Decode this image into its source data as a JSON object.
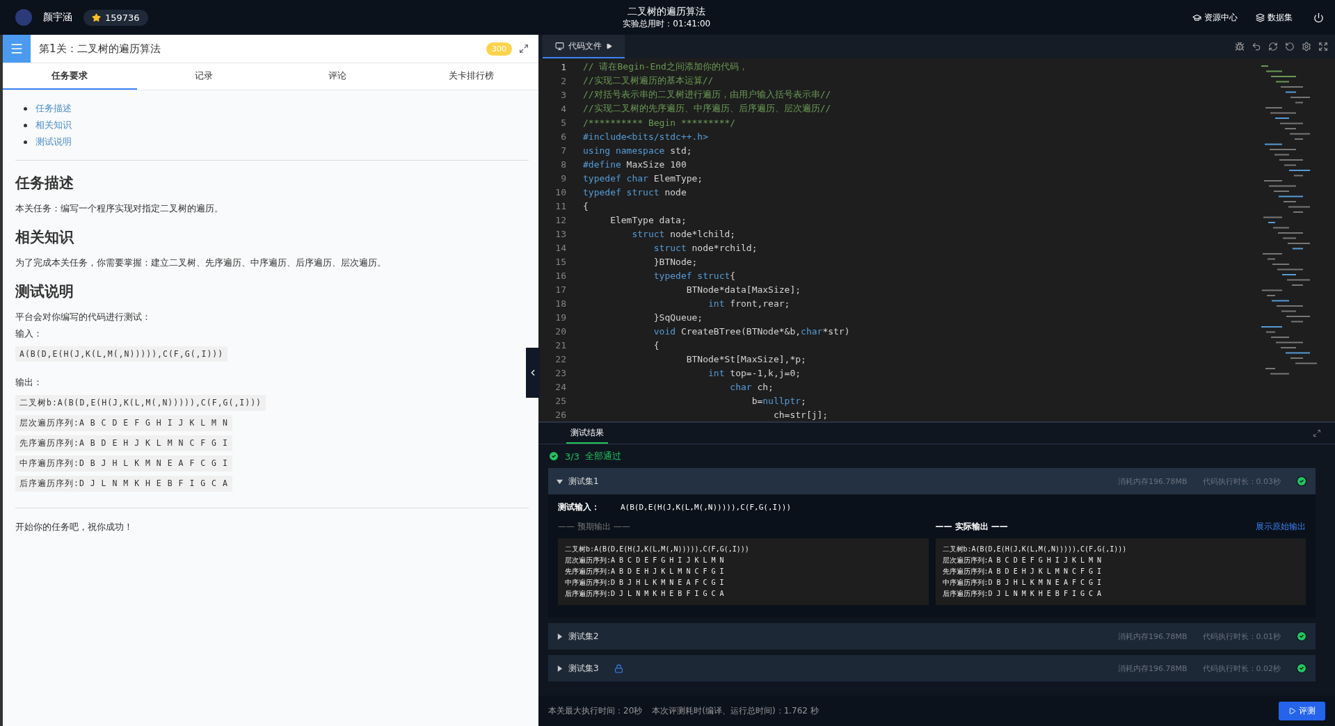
{
  "header": {
    "user_name": "颜宇涵",
    "coins": "159736",
    "title": "二叉树的遍历算法",
    "subtitle": "实验总用时：01:41:00",
    "links": [
      {
        "label": "资源中心",
        "kind": "resource"
      },
      {
        "label": "数据集",
        "kind": "dataset"
      }
    ]
  },
  "task": {
    "level_title": "第1关：二叉树的遍历算法",
    "score": "300",
    "tabs": [
      {
        "label": "任务要求",
        "selected": true
      },
      {
        "label": "记录",
        "selected": false
      },
      {
        "label": "评论",
        "selected": false
      },
      {
        "label": "关卡排行榜",
        "selected": false
      }
    ],
    "toc": [
      "任务描述",
      "相关知识",
      "测试说明"
    ],
    "sections": [
      {
        "heading": "任务描述",
        "blocks": [
          {
            "kind": "text",
            "text": "本关任务：编写一个程序实现对指定二叉树的遍历。"
          }
        ]
      },
      {
        "heading": "相关知识",
        "blocks": [
          {
            "kind": "text",
            "text": "为了完成本关任务，你需要掌握：建立二叉树、先序遍历、中序遍历、后序遍历、层次遍历。"
          }
        ]
      },
      {
        "heading": "测试说明",
        "blocks": [
          {
            "kind": "text",
            "text": "平台会对你编写的代码进行测试："
          },
          {
            "kind": "label",
            "text": "输入："
          },
          {
            "kind": "code",
            "text": "A(B(D,E(H(J,K(L,M(,N))))),C(F,G(,I)))"
          },
          {
            "kind": "label",
            "text": "输出："
          },
          {
            "kind": "code",
            "text": "二叉树b:A(B(D,E(H(J,K(L,M(,N))))),C(F,G(,I)))"
          },
          {
            "kind": "code",
            "text": "层次遍历序列:A B C D E F G H I J K L M N"
          },
          {
            "kind": "code",
            "text": "先序遍历序列:A B D E H J K L M N C F G I"
          },
          {
            "kind": "code",
            "text": "中序遍历序列:D B J H L K M N E A F C G I"
          },
          {
            "kind": "code",
            "text": "后序遍历序列:D J L N M K H E B F I G C A"
          }
        ]
      }
    ],
    "closing": "开始你的任务吧，祝你成功！"
  },
  "editor": {
    "tab_label": "代码文件",
    "lines": [
      {
        "n": "1",
        "tokens": [
          {
            "t": "// 请在Begin-End之间添加你的代码，",
            "kind": "comment"
          }
        ]
      },
      {
        "n": "2",
        "tokens": [
          {
            "t": "//实现二叉树遍历的基本运算//",
            "kind": "comment"
          }
        ]
      },
      {
        "n": "3",
        "tokens": [
          {
            "t": "//对括号表示串的二叉树进行遍历，由用户输入括号表示串//",
            "kind": "comment"
          }
        ]
      },
      {
        "n": "4",
        "tokens": [
          {
            "t": "//实现二叉树的先序遍历、中序遍历、后序遍历、层次遍历//",
            "kind": "comment"
          }
        ]
      },
      {
        "n": "5",
        "tokens": [
          {
            "t": "/********** Begin *********/",
            "kind": "comment"
          }
        ]
      },
      {
        "n": "6",
        "tokens": [
          {
            "t": "#include<bits/stdc++.h>",
            "kind": "keyword"
          }
        ]
      },
      {
        "n": "7",
        "tokens": [
          {
            "t": "using namespace",
            "kind": "keyword"
          },
          {
            "t": " std;",
            "kind": "plain"
          }
        ]
      },
      {
        "n": "8",
        "tokens": [
          {
            "t": "#define",
            "kind": "keyword"
          },
          {
            "t": " MaxSize 100",
            "kind": "plain"
          }
        ]
      },
      {
        "n": "9",
        "tokens": [
          {
            "t": "typedef char",
            "kind": "keyword"
          },
          {
            "t": " ElemType;",
            "kind": "plain"
          }
        ]
      },
      {
        "n": "10",
        "tokens": [
          {
            "t": "typedef struct",
            "kind": "keyword"
          },
          {
            "t": " node",
            "kind": "plain"
          }
        ]
      },
      {
        "n": "11",
        "tokens": [
          {
            "t": "{",
            "kind": "plain"
          }
        ]
      },
      {
        "n": "12",
        "tokens": [
          {
            "t": "     ElemType data;",
            "kind": "plain"
          }
        ]
      },
      {
        "n": "13",
        "tokens": [
          {
            "t": "         struct",
            "kind": "keyword"
          },
          {
            "t": " node*lchild;",
            "kind": "plain"
          }
        ]
      },
      {
        "n": "14",
        "tokens": [
          {
            "t": "             struct",
            "kind": "keyword"
          },
          {
            "t": " node*rchild;",
            "kind": "plain"
          }
        ]
      },
      {
        "n": "15",
        "tokens": [
          {
            "t": "             }BTNode;",
            "kind": "plain"
          }
        ]
      },
      {
        "n": "16",
        "tokens": [
          {
            "t": "             typedef struct",
            "kind": "keyword"
          },
          {
            "t": "{",
            "kind": "plain"
          }
        ]
      },
      {
        "n": "17",
        "tokens": [
          {
            "t": "                   BTNode*data[MaxSize];",
            "kind": "plain"
          }
        ]
      },
      {
        "n": "18",
        "tokens": [
          {
            "t": "                       int",
            "kind": "keyword"
          },
          {
            "t": " front,rear;",
            "kind": "plain"
          }
        ]
      },
      {
        "n": "19",
        "tokens": [
          {
            "t": "             }SqQueue;",
            "kind": "plain"
          }
        ]
      },
      {
        "n": "20",
        "tokens": [
          {
            "t": "             void",
            "kind": "keyword"
          },
          {
            "t": " CreateBTree(BTNode*&b,",
            "kind": "plain"
          },
          {
            "t": "char",
            "kind": "keyword"
          },
          {
            "t": "*str)",
            "kind": "plain"
          }
        ]
      },
      {
        "n": "21",
        "tokens": [
          {
            "t": "             {",
            "kind": "plain"
          }
        ]
      },
      {
        "n": "22",
        "tokens": [
          {
            "t": "                   BTNode*St[MaxSize],*p;",
            "kind": "plain"
          }
        ]
      },
      {
        "n": "23",
        "tokens": [
          {
            "t": "                       int",
            "kind": "keyword"
          },
          {
            "t": " top=-1,k,j=0;",
            "kind": "plain"
          }
        ]
      },
      {
        "n": "24",
        "tokens": [
          {
            "t": "                           char",
            "kind": "keyword"
          },
          {
            "t": " ch;",
            "kind": "plain"
          }
        ]
      },
      {
        "n": "25",
        "tokens": [
          {
            "t": "                               b=",
            "kind": "plain"
          },
          {
            "t": "nullptr",
            "kind": "keyword"
          },
          {
            "t": ";",
            "kind": "plain"
          }
        ]
      },
      {
        "n": "26",
        "tokens": [
          {
            "t": "                                   ch=str[j];",
            "kind": "plain"
          }
        ]
      }
    ]
  },
  "results": {
    "tab_label": "测试结果",
    "count": "3/3",
    "status": "全部通过",
    "input_label": "测试输入：",
    "input": "A(B(D,E(H(J,K(L,M(,N))))),C(F,G(,I)))",
    "expected_label": "—— 预期输出 ——",
    "actual_label": "—— 实际输出 ——",
    "raw_link": "展示原始输出",
    "expected_lines": [
      "二叉树b:A(B(D,E(H(J,K(L,M(,N))))),C(F,G(,I)))",
      "层次遍历序列:A B C D E F G H I J K L M N",
      "先序遍历序列:A B D E H J K L M N C F G I",
      "中序遍历序列:D B J H L K M N E A F C G I",
      "后序遍历序列:D J L N M K H E B F I G C A"
    ],
    "actual_lines": [
      "二叉树b:A(B(D,E(H(J,K(L,M(,N))))),C(F,G(,I)))",
      "层次遍历序列:A B C D E F G H I J K L M N",
      "先序遍历序列:A B D E H J K L M N C F G I",
      "中序遍历序列:D B J H L K M N E A F C G I",
      "后序遍历序列:D J L N M K H E B F I G C A"
    ],
    "sets": [
      {
        "name": "测试集1",
        "expanded": true,
        "locked": false,
        "memory": "消耗内存196.78MB",
        "time": "代码执行时长：0.03秒",
        "passed": true
      },
      {
        "name": "测试集2",
        "expanded": false,
        "locked": false,
        "memory": "消耗内存196.78MB",
        "time": "代码执行时长：0.01秒",
        "passed": true
      },
      {
        "name": "测试集3",
        "expanded": false,
        "locked": true,
        "memory": "消耗内存196.78MB",
        "time": "代码执行时长：0.02秒",
        "passed": true
      }
    ]
  },
  "footer": {
    "max_time": "本关最大执行时间：20秒",
    "eval_time": "本次评测耗时(编译、运行总时间)：1.762 秒",
    "button": "评测"
  }
}
